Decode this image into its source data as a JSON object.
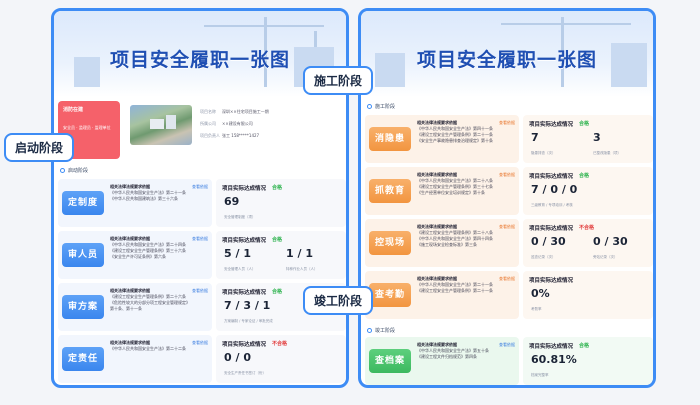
{
  "banner_title": "项目安全履职一张图",
  "labels": {
    "startup": "启动阶段",
    "construction": "施工阶段",
    "completion": "竣工阶段"
  },
  "left": {
    "project": {
      "status_title": "消防在建",
      "status_sub": "安全员 · 监理员 · 监理单位",
      "info": [
        {
          "k": "项目名称",
          "v": "深圳××住宅项目施工一期"
        },
        {
          "k": "所属公司",
          "v": "××建设有限公司"
        },
        {
          "k": "项目负责人",
          "v": "张工  158*****1427"
        }
      ]
    },
    "section": "启动阶段",
    "rows": [
      {
        "button": "定制度",
        "law_title": "相关法律法规要求依据",
        "law_lines": [
          "《中华人民共和国安全生产法》第二十一条",
          "《中华人民共和国建筑法》第三十六条"
        ],
        "tag": "查看依据",
        "rt": "项目实际达成情况",
        "status": "合格",
        "status_type": "ok",
        "values": [
          {
            "big": "69",
            "cap": "安全管理制度（项）"
          }
        ]
      },
      {
        "button": "审人员",
        "law_title": "相关法律法规要求依据",
        "law_lines": [
          "《中华人民共和国安全生产法》第二十四条",
          "《建设工程安全生产管理条例》第三十六条",
          "《安全生产许可证条例》第六条"
        ],
        "tag": "查看依据",
        "rt": "项目实际达成情况",
        "status": "合格",
        "status_type": "ok",
        "values": [
          {
            "big": "5 / 1",
            "cap": "安全管理人员（人）"
          },
          {
            "big": "1 / 1",
            "cap": "特种作业人员（人）"
          }
        ]
      },
      {
        "button": "审方案",
        "law_title": "相关法律法规要求依据",
        "law_lines": [
          "《建设工程安全生产管理条例》第二十六条",
          "《危险性较大的分部分项工程安全管理规定》",
          "第十条、第十一条"
        ],
        "tag": "查看依据",
        "rt": "项目实际达成情况",
        "status": "合格",
        "status_type": "ok",
        "values": [
          {
            "big": "7 / 3 / 1",
            "cap": "方案编制 / 专家论证 / 审批完成"
          }
        ]
      },
      {
        "button": "定责任",
        "law_title": "相关法律法规要求依据",
        "law_lines": [
          "《中华人民共和国安全生产法》第二十二条"
        ],
        "tag": "查看依据",
        "rt": "项目实际达成情况",
        "status": "不合格",
        "status_type": "bad",
        "values": [
          {
            "big": "0 / 0",
            "cap": "安全生产责任书签订（份）"
          }
        ]
      }
    ]
  },
  "right": {
    "section_construction": "施工阶段",
    "section_completion": "竣工阶段",
    "rows": [
      {
        "button": "消隐患",
        "color": "orange",
        "law_title": "相关法律法规要求依据",
        "law_lines": [
          "《中华人民共和国安全生产法》第四十一条",
          "《建设工程安全生产管理条例》第二十一条",
          "《安全生产事故隐患排查治理规定》第十条"
        ],
        "tag": "查看依据",
        "rt": "项目实际达成情况",
        "status": "合格",
        "status_type": "ok",
        "values": [
          {
            "big": "7",
            "cap": "隐患排查（次）"
          },
          {
            "big": "3",
            "cap": "已整改隐患（项）"
          }
        ]
      },
      {
        "button": "抓教育",
        "color": "orange",
        "law_title": "相关法律法规要求依据",
        "law_lines": [
          "《中华人民共和国安全生产法》第二十八条",
          "《建设工程安全生产管理条例》第三十七条",
          "《生产经营单位安全培训规定》第十条"
        ],
        "tag": "查看依据",
        "rt": "项目实际达成情况",
        "status": "合格",
        "status_type": "ok",
        "values": [
          {
            "big": "7 / 0 / 0",
            "cap": "三级教育 / 专项培训 / 考核"
          }
        ]
      },
      {
        "button": "控现场",
        "color": "orange",
        "law_title": "相关法律法规要求依据",
        "law_lines": [
          "《建设工程安全生产管理条例》第二十八条",
          "《中华人民共和国安全生产法》第四十四条",
          "《施工现场安全检查标准》第三条"
        ],
        "tag": "查看依据",
        "rt": "项目实际达成情况",
        "status": "不合格",
        "status_type": "bad",
        "values": [
          {
            "big": "0 / 30",
            "cap": "巡查记录（次）"
          },
          {
            "big": "0 / 30",
            "cap": "旁站记录（次）"
          }
        ]
      },
      {
        "button": "查考勤",
        "color": "orange",
        "law_title": "相关法律法规要求依据",
        "law_lines": [
          "《中华人民共和国安全生产法》第二十一条",
          "《建设工程安全生产管理条例》第二十一条"
        ],
        "tag": "查看依据",
        "rt": "项目实际达成情况",
        "status": "",
        "status_type": "ok",
        "values": [
          {
            "big": "0%",
            "cap": "考勤率"
          }
        ]
      },
      {
        "button": "查档案",
        "color": "green",
        "law_title": "相关法律法规要求依据",
        "law_lines": [
          "《中华人民共和国安全生产法》第五十条",
          "《建设工程文件归档规范》第四条"
        ],
        "tag": "查看依据",
        "rt": "项目实际达成情况",
        "status": "合格",
        "status_type": "ok",
        "values": [
          {
            "big": "60.81%",
            "cap": "档案完整率"
          }
        ]
      }
    ]
  }
}
